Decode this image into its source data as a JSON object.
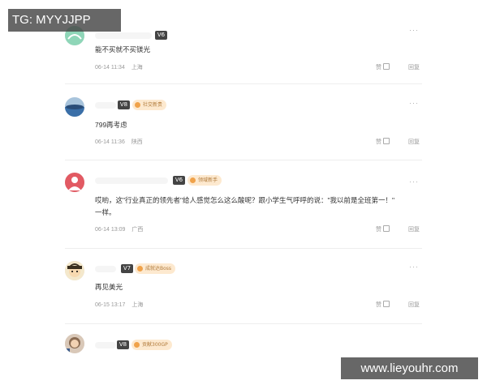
{
  "watermarks": {
    "top": "TG: MYYJJPP",
    "bottom": "www.lieyouhr.com"
  },
  "comments": [
    {
      "level": "V6",
      "tag": "",
      "text": "能不买就不买镁光",
      "time": "06-14 11:34",
      "location": "上海",
      "like_label": "赞",
      "reply_label": "回复",
      "more_label": "···"
    },
    {
      "level": "V8",
      "tag": "社交新贵",
      "text": "799再考虑",
      "time": "06-14 11:36",
      "location": "陕西",
      "like_label": "赞",
      "reply_label": "回复",
      "more_label": "···"
    },
    {
      "level": "V6",
      "tag": "领域新手",
      "text_line1": "哎哟，这\"行业真正的领先者\"给人感觉怎么这么酸呢？跟小学生气呼呼的说：\"我以前是全班第一！\"",
      "text_line2": "一样。",
      "time": "06-14 13:09",
      "location": "广西",
      "like_label": "赞",
      "reply_label": "回复",
      "more_label": "···"
    },
    {
      "level": "V7",
      "tag": "成就达Boss",
      "text": "再见美光",
      "time": "06-15 13:17",
      "location": "上海",
      "like_label": "赞",
      "reply_label": "回复",
      "more_label": "···"
    },
    {
      "level": "V8",
      "tag": "贡献300GP",
      "text": "",
      "time": "",
      "location": "",
      "more_label": ""
    }
  ],
  "colors": {
    "avatar_1": "#8fd6b8",
    "avatar_2": "#3a6fa8",
    "avatar_3": "#e25a63",
    "avatar_4": "#6b5a3a",
    "avatar_5": "#8a6b52"
  }
}
